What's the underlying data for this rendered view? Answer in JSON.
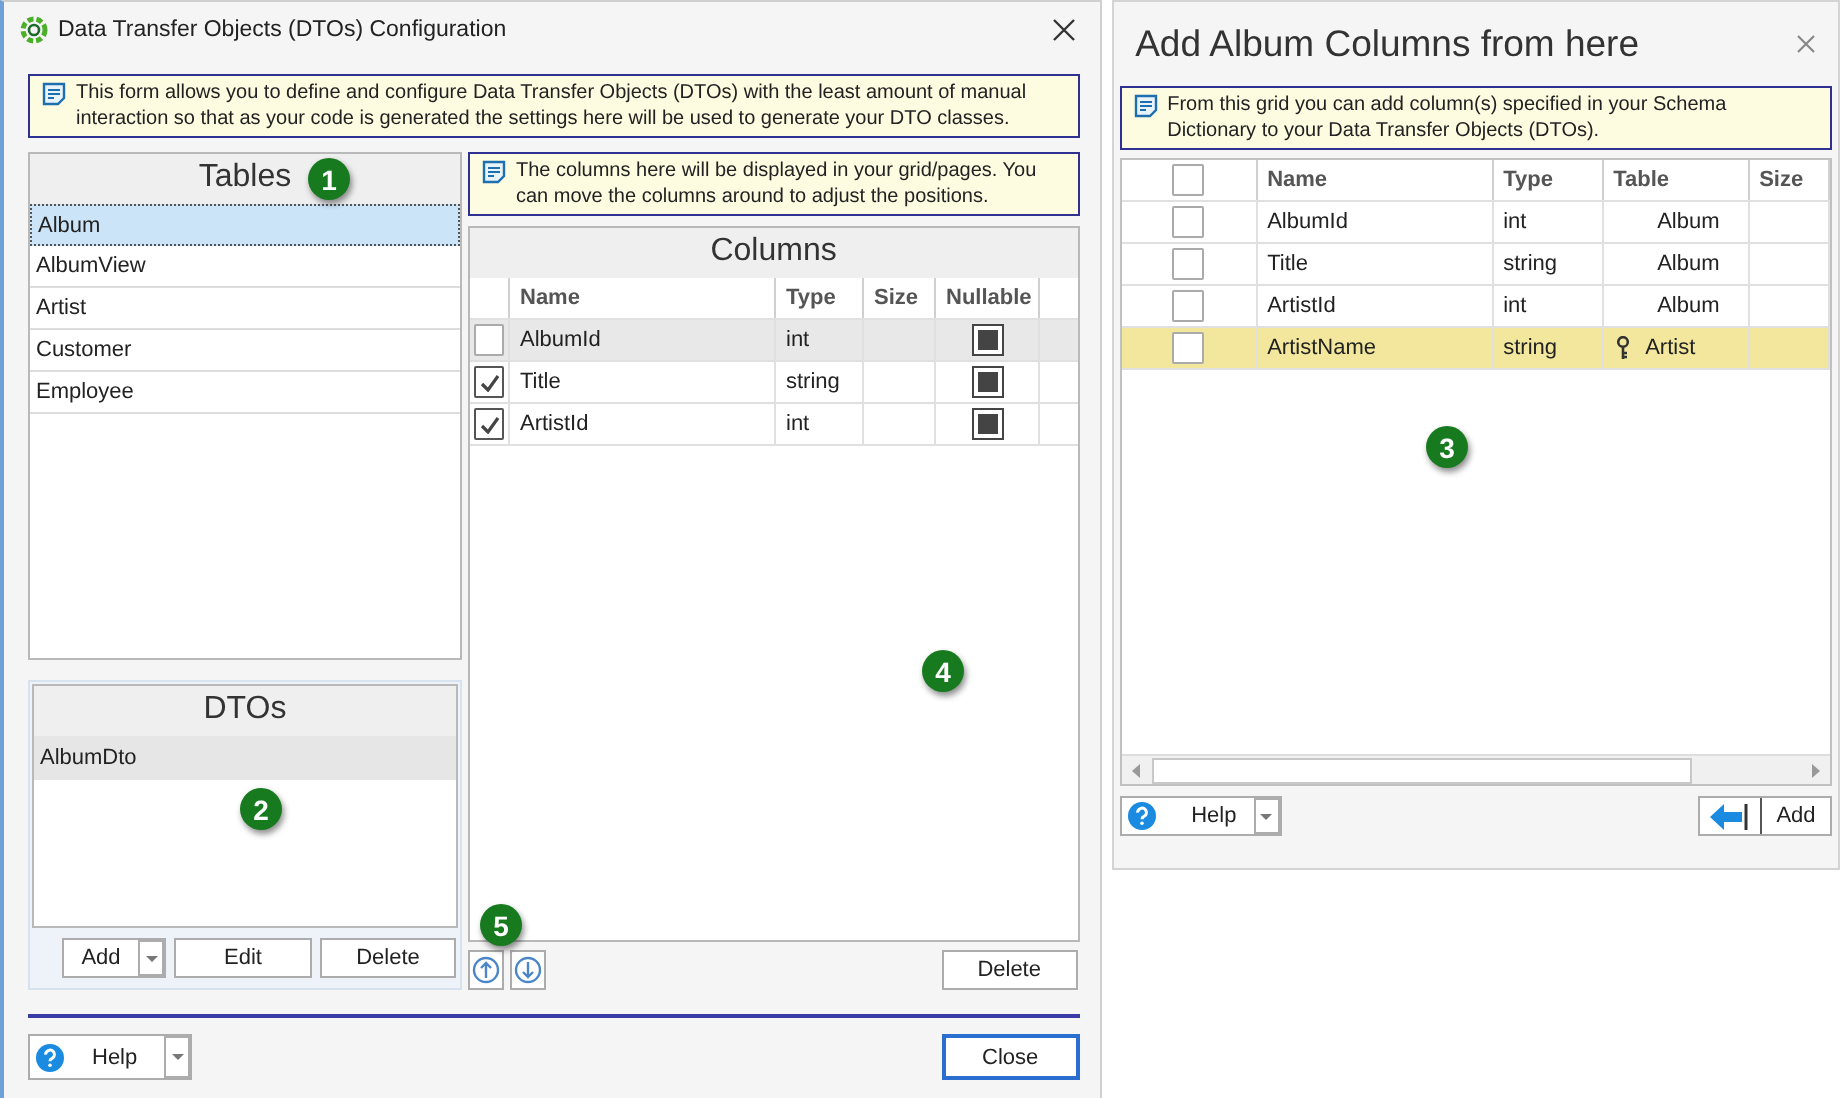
{
  "window": {
    "title": "Data Transfer Objects (DTOs) Configuration"
  },
  "info": "This form allows you to define and configure Data Transfer Objects (DTOs) with the least amount of manual interaction so that as your code is generated the settings here will be used to generate your DTO classes.",
  "tables": {
    "title": "Tables",
    "items": [
      {
        "label": "Album",
        "selected": true
      },
      {
        "label": "AlbumView",
        "selected": false
      },
      {
        "label": "Artist",
        "selected": false
      },
      {
        "label": "Customer",
        "selected": false
      },
      {
        "label": "Employee",
        "selected": false
      }
    ]
  },
  "dtos": {
    "title": "DTOs",
    "items": [
      {
        "label": "AlbumDto",
        "selected": true
      }
    ],
    "buttons": [
      "Add",
      "Edit",
      "Delete"
    ]
  },
  "columns": {
    "info": "The columns here will be displayed in your grid/pages. You can move the columns around to adjust the positions.",
    "title": "Columns",
    "headers": [
      "Name",
      "Type",
      "Size",
      "Nullable"
    ],
    "rows": [
      {
        "checked": false,
        "selected": true,
        "name": "AlbumId",
        "type": "int",
        "nullable": true
      },
      {
        "checked": true,
        "selected": false,
        "name": "Title",
        "type": "string",
        "nullable": true
      },
      {
        "checked": true,
        "selected": false,
        "name": "ArtistId",
        "type": "int",
        "nullable": true
      }
    ],
    "delete": "Delete"
  },
  "footer": {
    "help": "Help",
    "close": "Close"
  },
  "add_dialog": {
    "title": "Add Album Columns from here",
    "info": "From this grid you can add column(s) specified in your Schema Dictionary to your Data Transfer Objects (DTOs).",
    "header_checked": false,
    "headers": [
      "Name",
      "Type",
      "Table",
      "Size"
    ],
    "rows": [
      {
        "checked": false,
        "selected": false,
        "name": "AlbumId",
        "type": "int",
        "table": "Album",
        "key": false
      },
      {
        "checked": false,
        "selected": false,
        "name": "Title",
        "type": "string",
        "table": "Album",
        "key": false
      },
      {
        "checked": false,
        "selected": false,
        "name": "ArtistId",
        "type": "int",
        "table": "Album",
        "key": false
      },
      {
        "checked": false,
        "selected": true,
        "name": "ArtistName",
        "type": "string",
        "table": "Artist",
        "key": true
      }
    ],
    "help": "Help",
    "add": "Add"
  },
  "callouts": [
    "1",
    "2",
    "3",
    "4",
    "5"
  ]
}
